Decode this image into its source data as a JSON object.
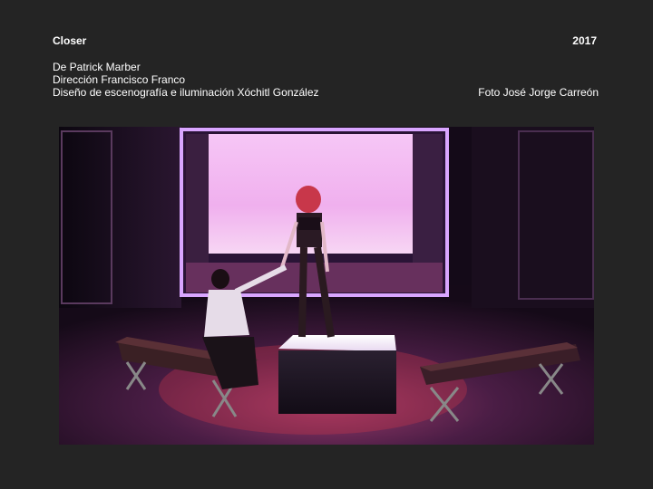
{
  "production": {
    "title": "Closer",
    "year": "2017",
    "author": "De Patrick Marber",
    "director": "Dirección Francisco Franco",
    "design": "Diseño de escenografía e iluminación Xóchitl González",
    "photo_credit": "Foto José Jorge Carreón"
  },
  "photo": {
    "subject": "stage-scene",
    "colors": {
      "backlight": "#f2b6f0",
      "frame_light": "#d9a6ff",
      "stage_floor": "#3a1a3a",
      "accent_red": "#c8374a"
    }
  }
}
